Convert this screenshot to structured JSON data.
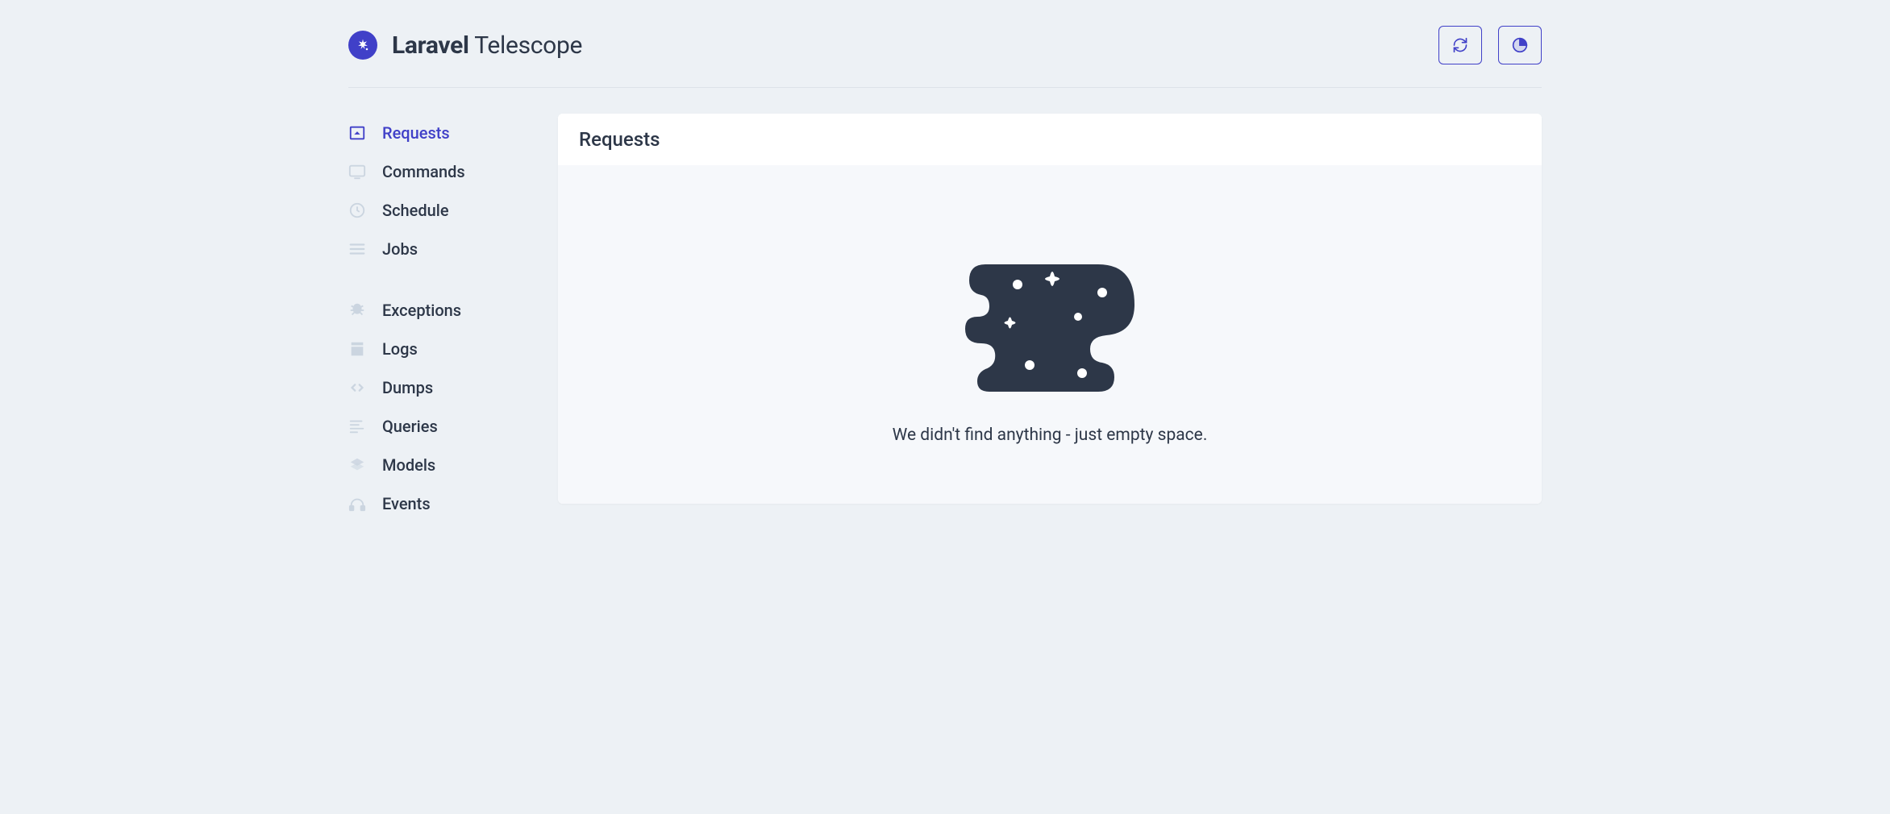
{
  "brand": {
    "bold": "Laravel",
    "light": "Telescope"
  },
  "toolbar": {
    "refresh_title": "Auto load entries",
    "dashboard_title": "Monitoring"
  },
  "sidebar": {
    "group1": [
      {
        "label": "Requests",
        "icon": "requests-icon",
        "active": true
      },
      {
        "label": "Commands",
        "icon": "commands-icon",
        "active": false
      },
      {
        "label": "Schedule",
        "icon": "schedule-icon",
        "active": false
      },
      {
        "label": "Jobs",
        "icon": "jobs-icon",
        "active": false
      }
    ],
    "group2": [
      {
        "label": "Exceptions",
        "icon": "exceptions-icon",
        "active": false
      },
      {
        "label": "Logs",
        "icon": "logs-icon",
        "active": false
      },
      {
        "label": "Dumps",
        "icon": "dumps-icon",
        "active": false
      },
      {
        "label": "Queries",
        "icon": "queries-icon",
        "active": false
      },
      {
        "label": "Models",
        "icon": "models-icon",
        "active": false
      },
      {
        "label": "Events",
        "icon": "events-icon",
        "active": false
      }
    ]
  },
  "main": {
    "title": "Requests",
    "empty_text": "We didn't find anything - just empty space."
  },
  "colors": {
    "accent": "#4040c8"
  }
}
